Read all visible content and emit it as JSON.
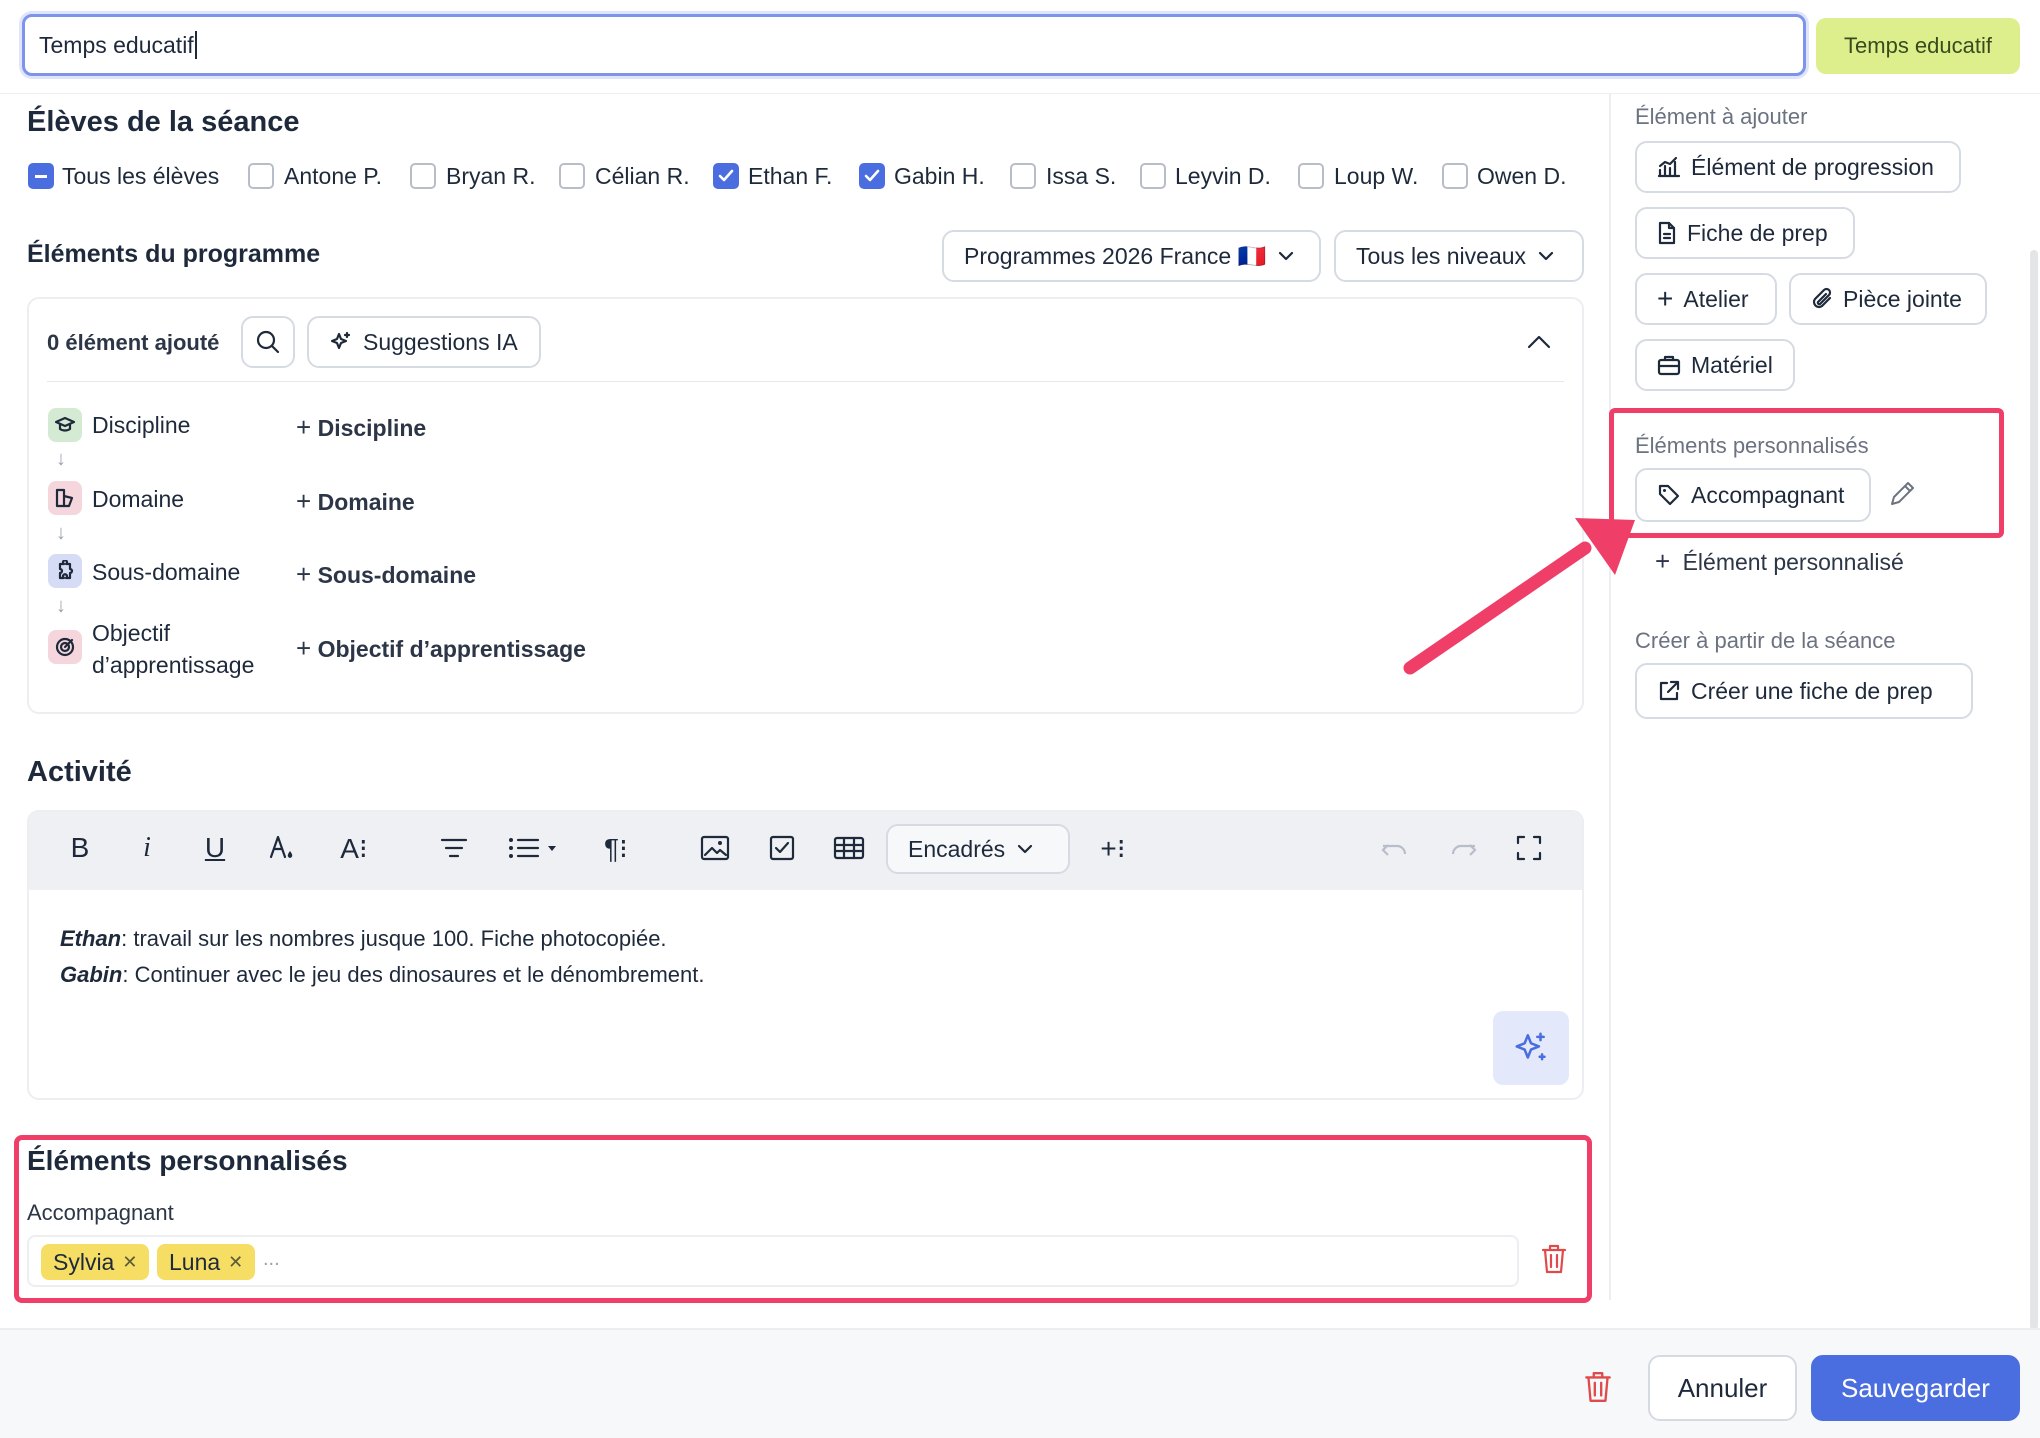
{
  "title_input": {
    "value": "Temps educatif"
  },
  "title_badge": "Temps educatif",
  "students": {
    "heading": "Élèves de la séance",
    "all_label": "Tous les élèves",
    "list": [
      {
        "name": "Antone P.",
        "checked": false
      },
      {
        "name": "Bryan R.",
        "checked": false
      },
      {
        "name": "Célian R.",
        "checked": false
      },
      {
        "name": "Ethan F.",
        "checked": true
      },
      {
        "name": "Gabin H.",
        "checked": true
      },
      {
        "name": "Issa S.",
        "checked": false
      },
      {
        "name": "Leyvin D.",
        "checked": false
      },
      {
        "name": "Loup W.",
        "checked": false
      },
      {
        "name": "Owen D.",
        "checked": false
      }
    ]
  },
  "program": {
    "heading": "Éléments du programme",
    "program_select": "Programmes 2026 France 🇫🇷",
    "level_select": "Tous les niveaux",
    "count_label": "0 élément ajouté",
    "ai_button": "Suggestions IA",
    "rows": [
      {
        "label": "Discipline",
        "add": "Discipline"
      },
      {
        "label": "Domaine",
        "add": "Domaine"
      },
      {
        "label": "Sous-domaine",
        "add": "Sous-domaine"
      },
      {
        "label_line1": "Objectif",
        "label_line2": "d’apprentissage",
        "add": "Objectif d’apprentissage"
      }
    ]
  },
  "activity": {
    "heading": "Activité",
    "boxes_select": "Encadrés",
    "lines": [
      {
        "name": "Ethan",
        "text": ": travail sur les nombres jusque 100. Fiche photocopiée."
      },
      {
        "name": "Gabin",
        "text": ": Continuer avec le jeu des dinosaures et le dénombrement."
      }
    ]
  },
  "custom_section": {
    "heading": "Éléments personnalisés",
    "field_label": "Accompagnant",
    "tags": [
      "Sylvia",
      "Luna"
    ],
    "placeholder": "..."
  },
  "sidebar": {
    "add_heading": "Élément à ajouter",
    "buttons": {
      "progression": "Élément de progression",
      "prep_sheet": "Fiche de prep",
      "workshop": "Atelier",
      "attachment": "Pièce jointe",
      "material": "Matériel"
    },
    "custom_heading": "Éléments personnalisés",
    "custom_item": "Accompagnant",
    "add_custom": "Élément personnalisé",
    "create_heading": "Créer à partir de la séance",
    "create_button": "Créer une fiche de prep"
  },
  "footer": {
    "cancel": "Annuler",
    "save": "Sauvegarder"
  },
  "colors": {
    "accent": "#4a6ee0",
    "highlight_frame": "#ef3e67",
    "tag": "#f6dd63",
    "badge": "#dcef8c"
  }
}
